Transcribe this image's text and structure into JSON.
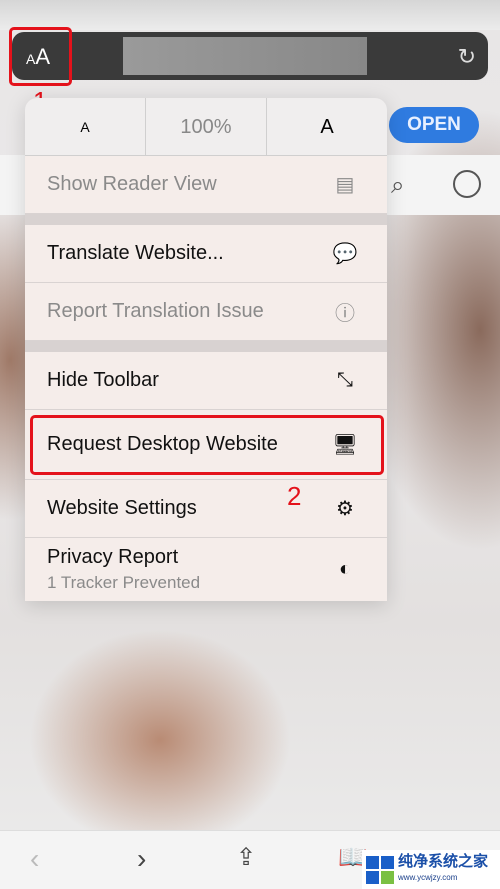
{
  "address_bar": {
    "format_button": "AA",
    "reload_icon": "reload-icon"
  },
  "annotations": {
    "step1": "1",
    "step2": "2",
    "highlight_color": "#e4121b"
  },
  "page": {
    "open_button": "OPEN"
  },
  "menu": {
    "font_row": {
      "smaller": "A",
      "zoom": "100%",
      "larger": "A"
    },
    "items": [
      {
        "label": "Show Reader View",
        "icon": "reader-icon",
        "disabled": true
      },
      {
        "label": "Translate Website...",
        "icon": "translate-icon",
        "disabled": false
      },
      {
        "label": "Report Translation Issue",
        "icon": "exclamation-circle-icon",
        "disabled": true
      },
      {
        "label": "Hide Toolbar",
        "icon": "expand-arrows-icon",
        "disabled": false
      },
      {
        "label": "Request Desktop Website",
        "icon": "desktop-icon",
        "disabled": false
      },
      {
        "label": "Website Settings",
        "icon": "gear-icon",
        "disabled": false
      },
      {
        "label": "Privacy Report",
        "sublabel": "1 Tracker Prevented",
        "icon": "shield-icon",
        "disabled": false
      }
    ]
  },
  "watermark": {
    "title": "纯净系统之家",
    "url": "www.ycwjzy.com"
  }
}
